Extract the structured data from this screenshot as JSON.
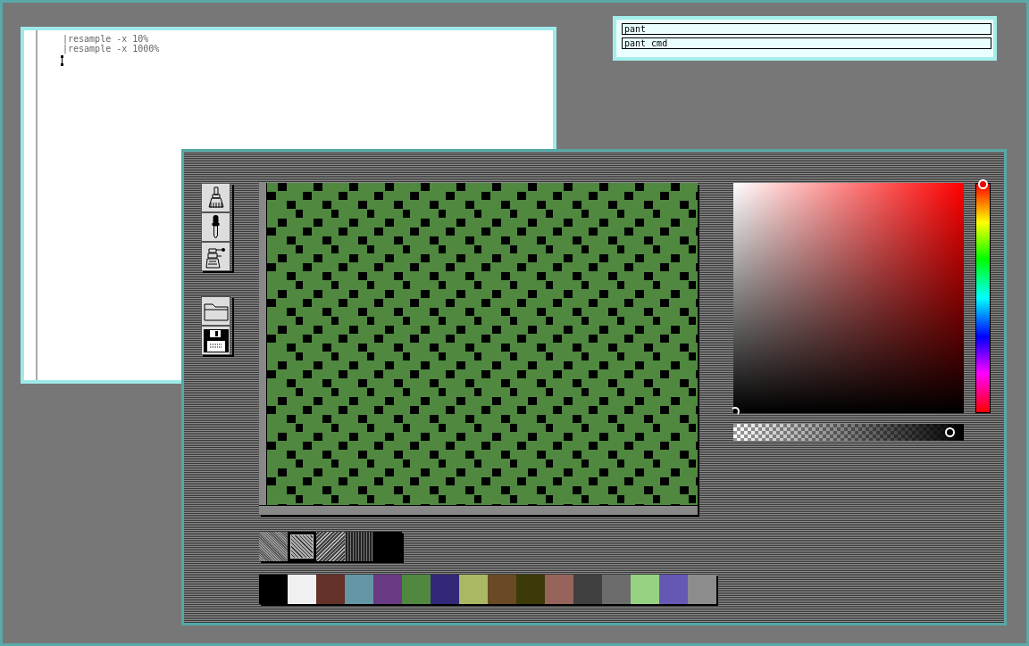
{
  "terminal": {
    "lines": [
      "|resample -x 10%",
      "|resample -x 1000%"
    ]
  },
  "labels": {
    "fields": [
      "pant",
      "pant cmd"
    ]
  },
  "paint": {
    "tools": [
      {
        "kind": "brush",
        "selected": false
      },
      {
        "kind": "dropper",
        "selected": false
      },
      {
        "kind": "robot",
        "selected": false
      }
    ],
    "file_tools": [
      {
        "kind": "folder"
      },
      {
        "kind": "floppy"
      }
    ],
    "hue": {
      "level": 0
    },
    "alpha": {
      "level": 0.95
    },
    "patterns": [
      {
        "kind": "fine",
        "selected": false
      },
      {
        "kind": "weave",
        "selected": true
      },
      {
        "kind": "zigzag",
        "selected": false
      },
      {
        "kind": "dots",
        "selected": false
      },
      {
        "kind": "solid",
        "selected": false
      }
    ],
    "palette": [
      {
        "color": "#000000"
      },
      {
        "color": "#f0f0f0"
      },
      {
        "color": "#643228"
      },
      {
        "color": "#6496a6"
      },
      {
        "color": "#6a3a84"
      },
      {
        "color": "#508840"
      },
      {
        "color": "#322878"
      },
      {
        "color": "#aab864"
      },
      {
        "color": "#6a4a24"
      },
      {
        "color": "#3c3a08"
      },
      {
        "color": "#96645a"
      },
      {
        "color": "#404040"
      },
      {
        "color": "#6c6c6c"
      },
      {
        "color": "#96d282"
      },
      {
        "color": "#6458b4"
      },
      {
        "color": "#8c8c8c"
      }
    ]
  }
}
